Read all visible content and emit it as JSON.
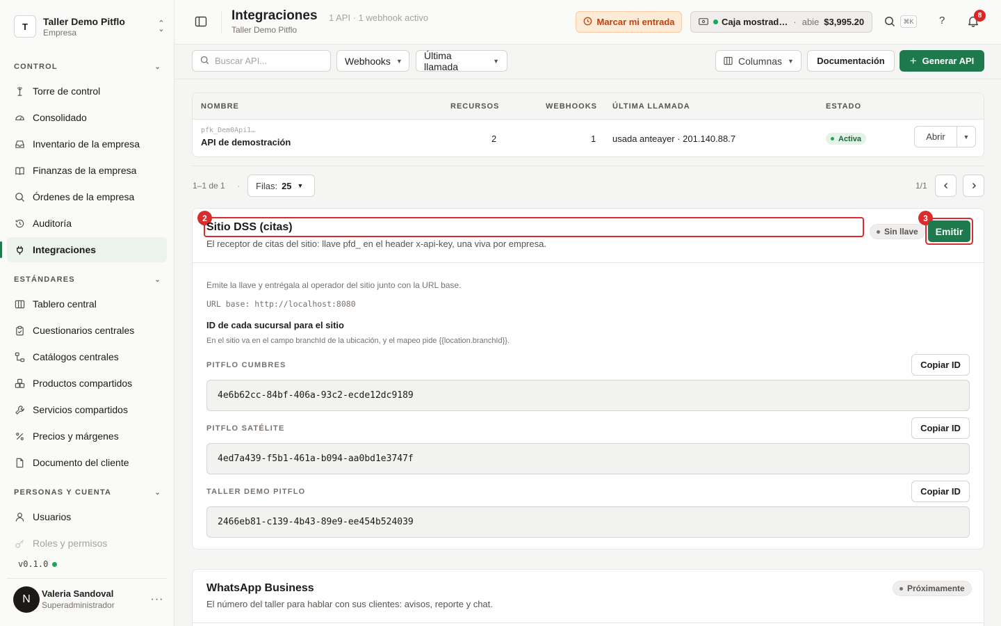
{
  "org": {
    "initial": "T",
    "name": "Taller Demo Pitflo",
    "type": "Empresa"
  },
  "sections": {
    "control": "CONTROL",
    "estandares": "ESTÁNDARES",
    "personas": "PERSONAS Y CUENTA"
  },
  "nav": {
    "control": [
      {
        "label": "Torre de control",
        "icon": "tower-icon"
      },
      {
        "label": "Consolidado",
        "icon": "gauge-icon"
      },
      {
        "label": "Inventario de la empresa",
        "icon": "inbox-icon"
      },
      {
        "label": "Finanzas de la empresa",
        "icon": "book-icon"
      },
      {
        "label": "Órdenes de la empresa",
        "icon": "search-icon"
      },
      {
        "label": "Auditoría",
        "icon": "history-icon"
      },
      {
        "label": "Integraciones",
        "icon": "plug-icon",
        "active": true
      }
    ],
    "estandares": [
      {
        "label": "Tablero central",
        "icon": "columns-icon"
      },
      {
        "label": "Cuestionarios centrales",
        "icon": "clipboard-icon"
      },
      {
        "label": "Catálogos centrales",
        "icon": "tree-icon"
      },
      {
        "label": "Productos compartidos",
        "icon": "boxes-icon"
      },
      {
        "label": "Servicios compartidos",
        "icon": "wrench-icon"
      },
      {
        "label": "Precios y márgenes",
        "icon": "percent-icon"
      },
      {
        "label": "Documento del cliente",
        "icon": "document-icon"
      }
    ],
    "personas": [
      {
        "label": "Usuarios",
        "icon": "user-icon"
      },
      {
        "label": "Roles y permisos",
        "icon": "key-icon",
        "faded": true
      }
    ]
  },
  "version": "v0.1.0",
  "user": {
    "initial": "N",
    "name": "Valeria Sandoval",
    "role": "Superadministrador"
  },
  "header": {
    "title": "Integraciones",
    "subtitle": "Taller Demo Pitflo",
    "meta": "1 API · 1 webhook activo",
    "checkin_label": "Marcar mi entrada",
    "cash_name": "Caja mostrad…",
    "cash_sep": "·",
    "cash_status": "abie",
    "cash_amount": "$3,995.20",
    "kbd": "⌘K",
    "help": "?",
    "notifications": "8"
  },
  "toolbar": {
    "search_placeholder": "Buscar API...",
    "filter_webhooks": "Webhooks",
    "filter_last_call": "Última llamada",
    "columns": "Columnas",
    "docs": "Documentación",
    "generate": "Generar API"
  },
  "table": {
    "headers": [
      "NOMBRE",
      "RECURSOS",
      "WEBHOOKS",
      "ÚLTIMA LLAMADA",
      "ESTADO"
    ],
    "rows": [
      {
        "key": "pfk_Dem0Api1…",
        "name": "API de demostración",
        "resources": "2",
        "webhooks": "1",
        "last_call": "usada anteayer · 201.140.88.7",
        "status": "Activa",
        "open": "Abrir"
      }
    ]
  },
  "pager": {
    "range": "1–1 de 1",
    "dot": "·",
    "rows_label": "Filas:",
    "rows_value": "25",
    "page": "1/1"
  },
  "dss": {
    "marker_title": "2",
    "marker_emit": "3",
    "title": "Sitio DSS (citas)",
    "description": "El receptor de citas del sitio: llave pfd_ en el header x-api-key, una viva por empresa.",
    "key_status": "Sin llave",
    "emit": "Emitir",
    "intro": "Emite la llave y entrégala al operador del sitio junto con la URL base.",
    "url_base": "URL base: http://localhost:8080",
    "branch_title": "ID de cada sucursal para el sitio",
    "branch_desc": "En el sitio va en el campo branchId de la ubicación, y el mapeo pide {{location.branchId}}.",
    "copy_label": "Copiar ID",
    "branches": [
      {
        "name": "PITFLO CUMBRES",
        "id": "4e6b62cc-84bf-406a-93c2-ecde12dc9189"
      },
      {
        "name": "PITFLO SATÉLITE",
        "id": "4ed7a439-f5b1-461a-b094-aa0bd1e3747f"
      },
      {
        "name": "TALLER DEMO PITFLO",
        "id": "2466eb81-c139-4b43-89e9-ee454b524039"
      }
    ]
  },
  "whatsapp": {
    "title": "WhatsApp Business",
    "description": "El número del taller para hablar con sus clientes: avisos, reporte y chat.",
    "status": "Próximamente"
  },
  "colors": {
    "accent": "#1e7a4c",
    "highlight": "#d92d2d",
    "warning_bg": "#fdebd8"
  }
}
